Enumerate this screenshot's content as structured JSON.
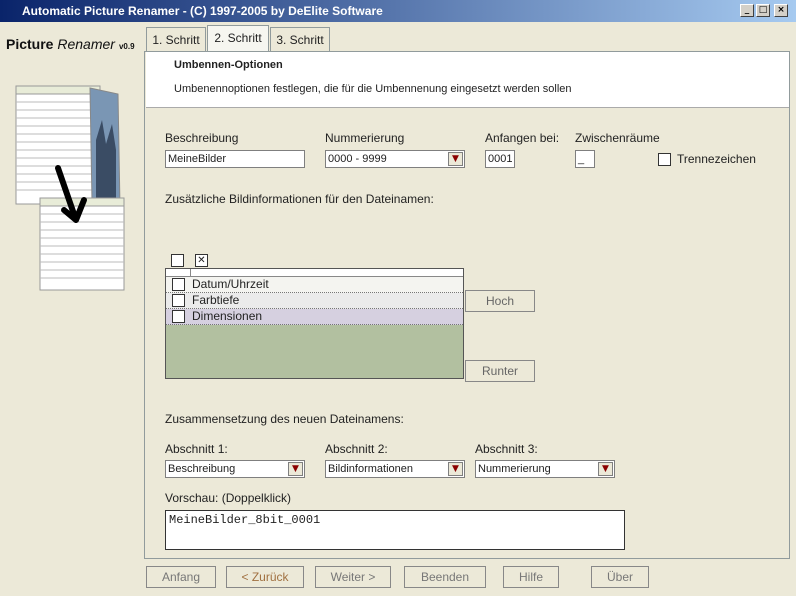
{
  "window": {
    "title": "Automatic Picture Renamer - (C) 1997-2005 by DeElite Software",
    "minimize": "_",
    "maximize": "□",
    "close": "×"
  },
  "logo": {
    "word1": "Picture",
    "word2": "Renamer",
    "version": "v0.9"
  },
  "tabs": [
    {
      "label": "1. Schritt"
    },
    {
      "label": "2. Schritt"
    },
    {
      "label": "3. Schritt"
    }
  ],
  "header": {
    "title": "Umbennen-Optionen",
    "subtitle": "Umbenennoptionen festlegen, die für die Umbennenung eingesetzt werden sollen"
  },
  "form": {
    "beschreibung_label": "Beschreibung",
    "beschreibung_value": "MeineBilder",
    "nummerierung_label": "Nummerierung",
    "nummerierung_value": "0000 - 9999",
    "anfangen_label": "Anfangen bei:",
    "anfangen_value": "0001",
    "zwischenraeume_label": "Zwischenräume",
    "zwischenraeume_value": "_",
    "trennezeichen_label": "Trennezeichen"
  },
  "bildinfo": {
    "heading": "Zusätzliche Bildinformationen für den Dateinamen:",
    "select_none": "",
    "select_all": "✕",
    "items": [
      {
        "label": "Datum/Uhrzeit"
      },
      {
        "label": "Farbtiefe"
      },
      {
        "label": "Dimensionen"
      }
    ],
    "up_button": "Hoch",
    "down_button": "Runter"
  },
  "composition": {
    "heading": "Zusammensetzung des neuen Dateinamens:",
    "abschnitt1_label": "Abschnitt 1:",
    "abschnitt1_value": "Beschreibung",
    "abschnitt2_label": "Abschnitt 2:",
    "abschnitt2_value": "Bildinformationen",
    "abschnitt3_label": "Abschnitt 3:",
    "abschnitt3_value": "Nummerierung",
    "preview_label": "Vorschau: (Doppelklick)",
    "preview_value": "MeineBilder_8bit_0001"
  },
  "nav": {
    "anfang": "Anfang",
    "zurueck": "< Zurück",
    "weiter": "Weiter >",
    "beenden": "Beenden",
    "hilfe": "Hilfe",
    "ueber": "Über"
  },
  "colors": {
    "titlebar_start": "#0a246a",
    "list_bg": "#b2c0a0",
    "dropdown_arrow": "#8b0000"
  }
}
